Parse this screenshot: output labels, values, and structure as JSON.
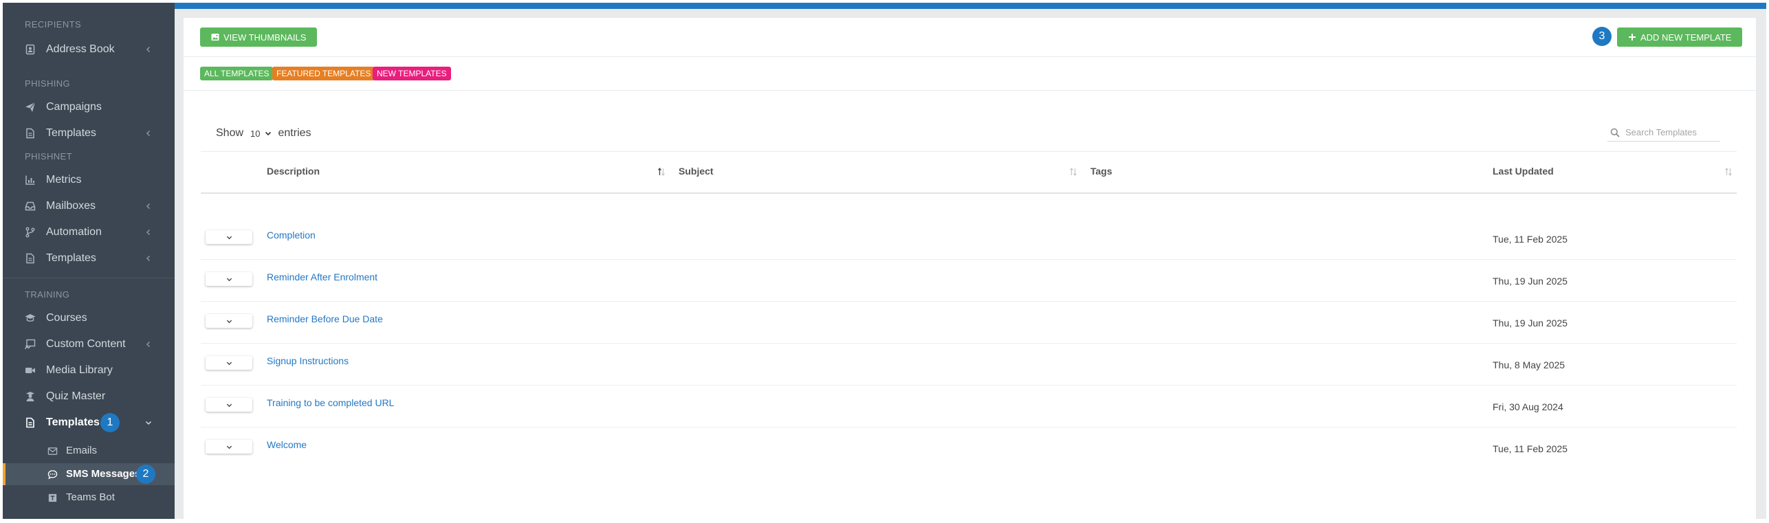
{
  "sidebar": {
    "sections": {
      "recipients": "RECIPIENTS",
      "phishing": "PHISHING",
      "phishnet": "PHISHNET",
      "training": "TRAINING"
    },
    "items": {
      "address_book": "Address Book",
      "campaigns": "Campaigns",
      "phishing_templates": "Templates",
      "metrics": "Metrics",
      "mailboxes": "Mailboxes",
      "automation": "Automation",
      "phishnet_templates": "Templates",
      "courses": "Courses",
      "custom_content": "Custom Content",
      "media_library": "Media Library",
      "quiz_master": "Quiz Master",
      "training_templates": "Templates"
    },
    "subitems": {
      "emails": "Emails",
      "sms_messages": "SMS Messages",
      "teams_bot": "Teams Bot"
    },
    "badges": {
      "templates": "1",
      "sms": "2"
    }
  },
  "toolbar": {
    "view_thumbnails": "VIEW THUMBNAILS",
    "add_new_template": "ADD NEW TEMPLATE",
    "add_badge": "3"
  },
  "filters": {
    "all": "ALL TEMPLATES",
    "featured": "FEATURED TEMPLATES",
    "new": "NEW TEMPLATES"
  },
  "table_controls": {
    "show": "Show",
    "page_size": "10",
    "entries": "entries",
    "search_placeholder": "Search Templates"
  },
  "table": {
    "columns": {
      "description": "Description",
      "subject": "Subject",
      "tags": "Tags",
      "last_updated": "Last Updated"
    },
    "rows": [
      {
        "description": "Completion",
        "last_updated": "Tue, 11 Feb 2025"
      },
      {
        "description": "Reminder After Enrolment",
        "last_updated": "Thu, 19 Jun 2025"
      },
      {
        "description": "Reminder Before Due Date",
        "last_updated": "Thu, 19 Jun 2025"
      },
      {
        "description": "Signup Instructions",
        "last_updated": "Thu, 8 May 2025"
      },
      {
        "description": "Training to be completed URL",
        "last_updated": "Fri, 30 Aug 2024"
      },
      {
        "description": "Welcome",
        "last_updated": "Tue, 11 Feb 2025"
      }
    ]
  },
  "colors": {
    "sidebar_bg": "#3b4652",
    "accent_blue": "#1f79c2",
    "green": "#5cb85c",
    "orange": "#e67e22",
    "pink": "#e91e7d",
    "link": "#2378c4",
    "active_marker": "#f0a430"
  }
}
